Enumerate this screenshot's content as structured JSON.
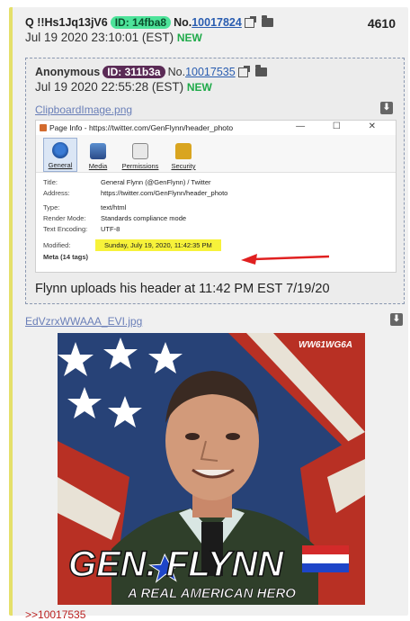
{
  "post": {
    "author": "Q !!Hs1Jq13jV6",
    "id_label": "ID: 14fba8",
    "no_prefix": "No.",
    "no": "10017824",
    "date": "Jul 19 2020 23:10:01 (EST)",
    "new_tag": "NEW",
    "count": "4610"
  },
  "quoted": {
    "author": "Anonymous",
    "id_label": "ID: 311b3a",
    "no_prefix": "No.",
    "no": "10017535",
    "date": "Jul 19 2020 22:55:28 (EST)",
    "new_tag": "NEW",
    "file_name": "ClipboardImage.png",
    "caption": "Flynn uploads his header at 11:42 PM EST 7/19/20"
  },
  "page_info": {
    "window_title": "Page Info - https://twitter.com/GenFlynn/header_photo",
    "window_controls": "—  ☐  ✕",
    "tabs": [
      {
        "label": "General",
        "icon": "general-icon"
      },
      {
        "label": "Media",
        "icon": "media-icon"
      },
      {
        "label": "Permissions",
        "icon": "permissions-icon"
      },
      {
        "label": "Security",
        "icon": "security-icon"
      }
    ],
    "rows": [
      {
        "key": "Title:",
        "value": "General Flynn (@GenFlynn) / Twitter"
      },
      {
        "key": "Address:",
        "value": "https://twitter.com/GenFlynn/header_photo"
      },
      {
        "key": "Type:",
        "value": "text/html"
      },
      {
        "key": "Render Mode:",
        "value": "Standards compliance mode"
      },
      {
        "key": "Text Encoding:",
        "value": "UTF-8"
      },
      {
        "key": "Modified:",
        "value": "Sunday, July 19, 2020, 11:42:35 PM"
      }
    ],
    "meta_tags": "Meta (14 tags)",
    "highlight_color": "#f7f23a",
    "arrow_color": "#e02020"
  },
  "attachment": {
    "file_name": "EdVzrxWWAAA_EVI.jpg",
    "watermark": "WW61WG6A",
    "headline": "GEN. FLYNN",
    "subline": "A REAL AMERICAN HERO"
  },
  "reply_link": ">>10017535",
  "download_glyph": "⬇"
}
